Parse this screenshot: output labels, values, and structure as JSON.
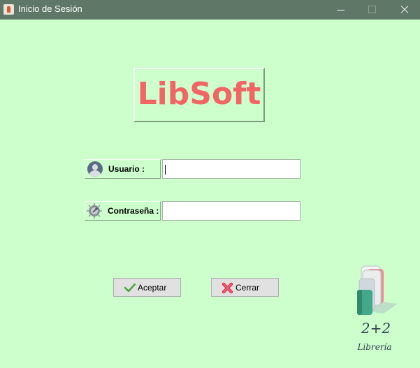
{
  "window": {
    "title": "Inicio de Sesión",
    "controls": [
      "minimize",
      "maximize",
      "close"
    ]
  },
  "logo": {
    "text": "LibSoft",
    "color": "#f36565"
  },
  "form": {
    "username_label": "Usuario :",
    "username_value": "",
    "password_label": "Contraseña :",
    "password_value": ""
  },
  "buttons": {
    "accept_label": "Aceptar",
    "close_label": "Cerrar"
  },
  "brand": {
    "number": "2+2",
    "name": "Librería"
  },
  "colors": {
    "background": "#ccffcc",
    "titlebar": "#5f7766"
  },
  "icons": {
    "app": "java-icon",
    "username": "user-icon",
    "password": "key-icon",
    "accept": "check-icon",
    "close": "x-icon"
  }
}
